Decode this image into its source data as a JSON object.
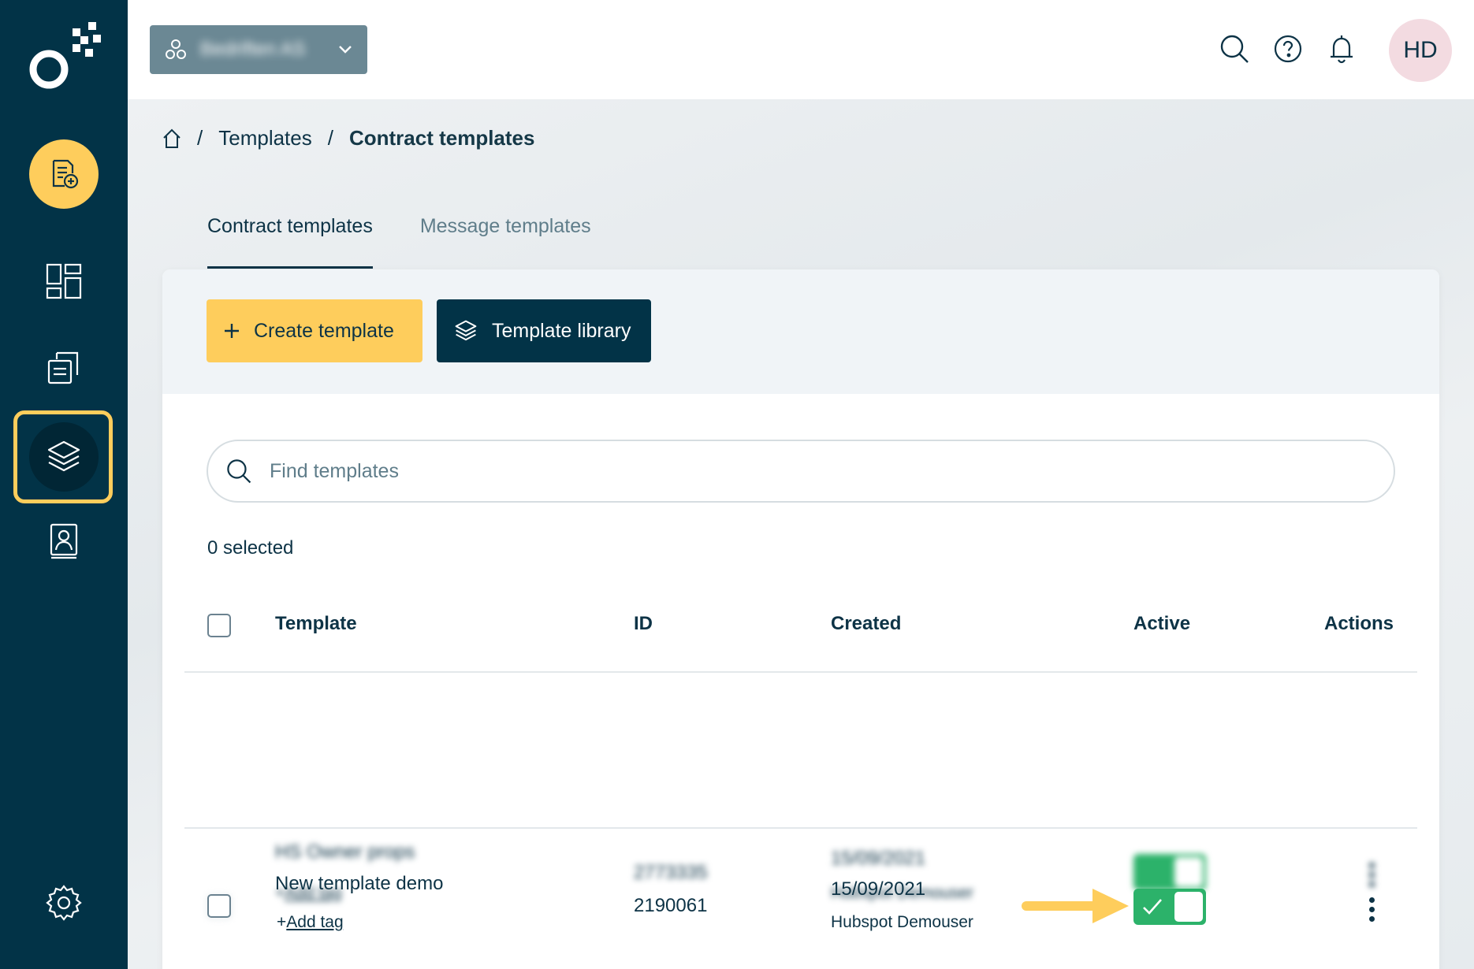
{
  "workspace": {
    "name": "Bedriften AS"
  },
  "topbar": {
    "avatar_initials": "HD"
  },
  "breadcrumb": {
    "items": [
      "Templates",
      "Contract templates"
    ]
  },
  "tabs": [
    {
      "label": "Contract templates",
      "active": true
    },
    {
      "label": "Message templates",
      "active": false
    }
  ],
  "actions": {
    "create_label": "Create template",
    "library_label": "Template library"
  },
  "search": {
    "placeholder": "Find templates",
    "value": ""
  },
  "selection": {
    "count_label": "0 selected"
  },
  "table": {
    "headers": {
      "template": "Template",
      "id": "ID",
      "created": "Created",
      "active": "Active",
      "actions": "Actions"
    },
    "rows": [
      {
        "name": "HS Owner props",
        "tag_label": "Add tag",
        "id": "2773335",
        "created_date": "15/09/2021",
        "created_by": "Hubspot Demouser",
        "active": true,
        "blurred": true
      },
      {
        "name": "New template demo",
        "tag_label": "Add tag",
        "id": "2190061",
        "created_date": "15/09/2021",
        "created_by": "Hubspot Demouser",
        "active": true,
        "blurred": false
      }
    ]
  },
  "colors": {
    "sidebar": "#023347",
    "accent_yellow": "#fecd5c",
    "toggle_green": "#2cb26a",
    "avatar_bg": "#f3dbe1"
  },
  "icons": {
    "sidebar": [
      "new-document-icon",
      "dashboard-icon",
      "documents-icon",
      "templates-layers-icon",
      "contacts-icon",
      "settings-gear-icon"
    ],
    "topbar": [
      "search-icon",
      "help-icon",
      "bell-icon"
    ]
  }
}
